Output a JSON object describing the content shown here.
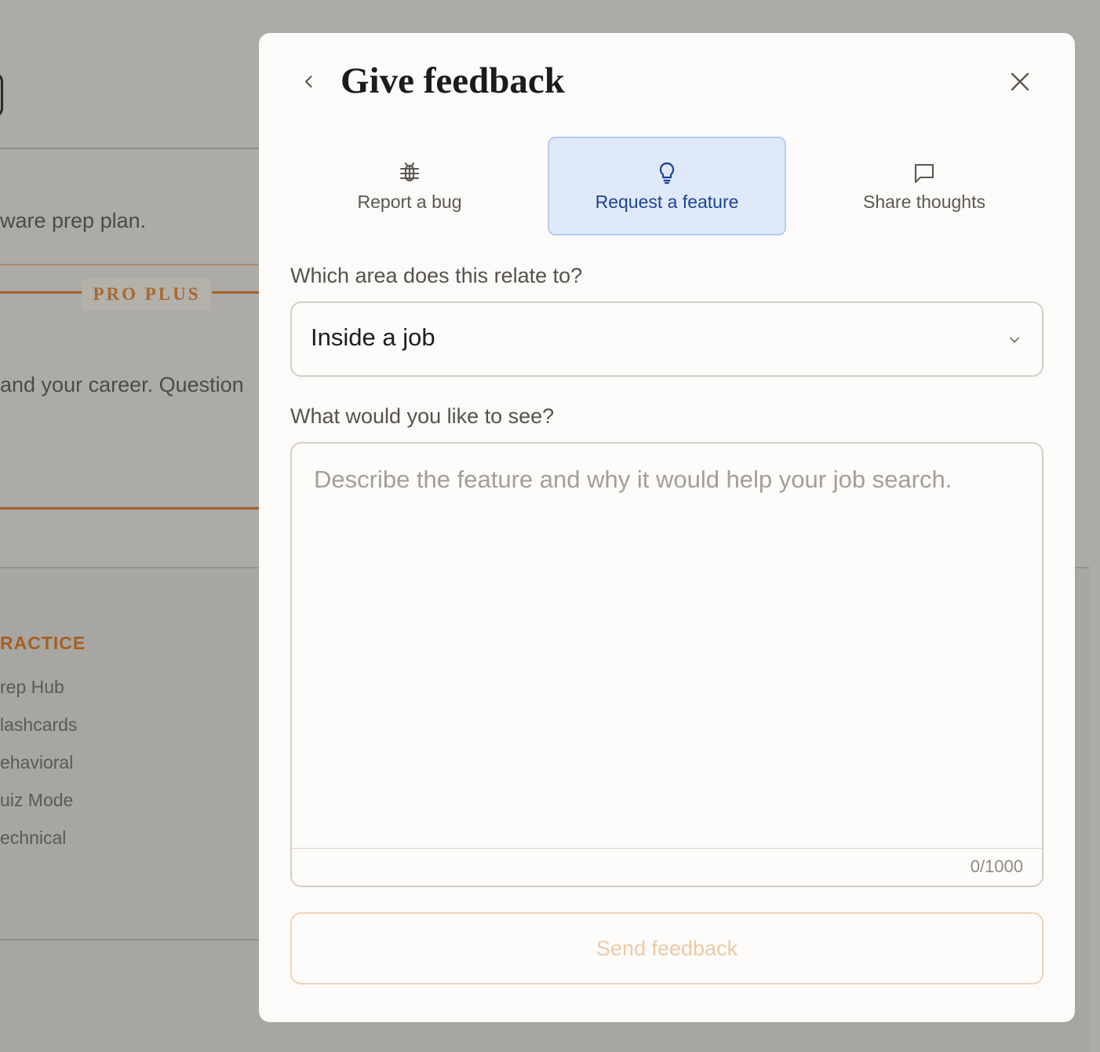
{
  "background": {
    "text_prep_plan": "ware prep plan.",
    "pro_badge": "PRO PLUS",
    "text_career": "and your career. Question",
    "section_title": "RACTICE",
    "links": [
      "rep Hub",
      "lashcards",
      "ehavioral",
      "uiz Mode",
      "echnical"
    ]
  },
  "modal": {
    "title": "Give feedback",
    "back_icon": "chevron-left-icon",
    "close_icon": "close-icon",
    "tabs": [
      {
        "label": "Report a bug",
        "icon": "bug-icon",
        "selected": false
      },
      {
        "label": "Request a feature",
        "icon": "lightbulb-icon",
        "selected": true
      },
      {
        "label": "Share thoughts",
        "icon": "message-square-icon",
        "selected": false
      }
    ],
    "area_label": "Which area does this relate to?",
    "area_value": "Inside a job",
    "details_label": "What would you like to see?",
    "details_placeholder": "Describe the feature and why it would help your job search.",
    "counter": "0/1000",
    "send_label": "Send feedback"
  },
  "colors": {
    "accent_blue": "#1d4397",
    "selected_tab_bg": "#dfe9f9",
    "send_disabled": "#ecc9a6",
    "brand_orange": "#a46228"
  }
}
